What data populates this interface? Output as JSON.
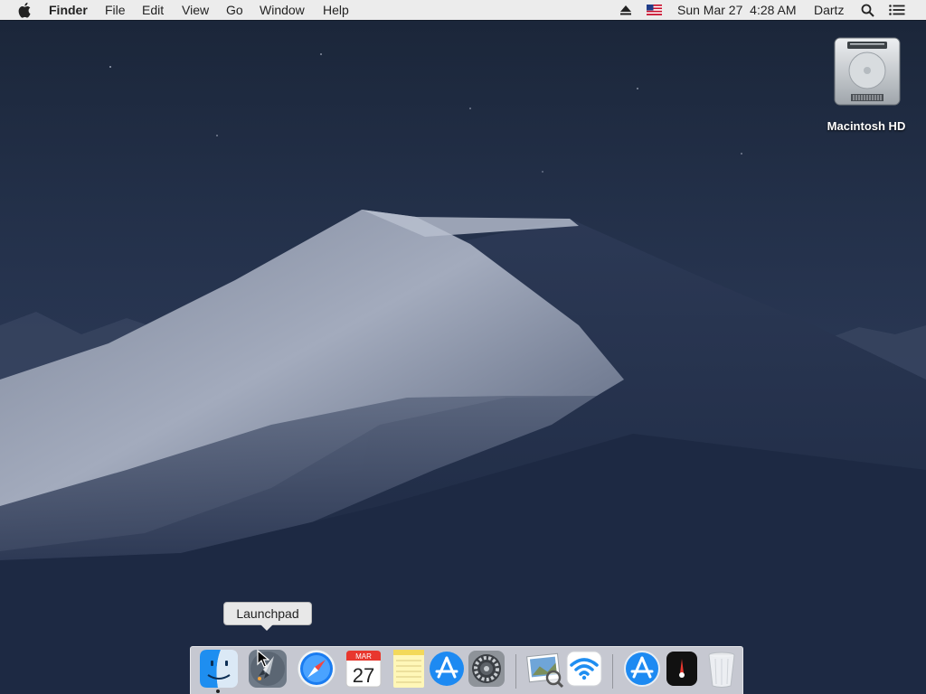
{
  "menubar": {
    "apple": "apple-icon",
    "app_name": "Finder",
    "menus": [
      "File",
      "Edit",
      "View",
      "Go",
      "Window",
      "Help"
    ],
    "status": {
      "eject": "eject-icon",
      "input_source": "us-flag-icon",
      "datetime": "Sun Mar 27  4:28 AM",
      "user": "Dartz",
      "spotlight": "spotlight-search-icon",
      "notification_center": "notification-center-icon"
    }
  },
  "desktop": {
    "wallpaper": "Mojave dark dunes",
    "icons": [
      {
        "label": "Macintosh HD",
        "icon": "hard-drive-icon"
      }
    ]
  },
  "tooltip": {
    "text": "Launchpad"
  },
  "dock": {
    "calendar": {
      "month": "MAR",
      "day": "27"
    },
    "items": [
      {
        "name": "Finder",
        "icon": "finder-icon",
        "running": true
      },
      {
        "name": "Launchpad",
        "icon": "launchpad-icon",
        "running": false
      },
      {
        "name": "Safari",
        "icon": "safari-icon",
        "running": false
      },
      {
        "name": "Calendar",
        "icon": "calendar-icon",
        "running": false
      },
      {
        "name": "Notes",
        "icon": "notes-icon",
        "running": false
      },
      {
        "name": "App Store",
        "icon": "app-store-icon",
        "running": false
      },
      {
        "name": "System Preferences",
        "icon": "system-preferences-icon",
        "running": false
      },
      {
        "name": "Preview",
        "icon": "preview-icon",
        "running": false
      },
      {
        "name": "Wireless Diagnostics",
        "icon": "wifi-icon",
        "running": false
      },
      {
        "name": "App Store Downloads",
        "icon": "downloads-app-store-icon",
        "running": false
      },
      {
        "name": "Dashboard",
        "icon": "dashboard-icon",
        "running": false
      },
      {
        "name": "Trash",
        "icon": "trash-icon",
        "running": false
      }
    ]
  },
  "colors": {
    "menubar_bg": "#ececec",
    "sky_dark": "#1a2538",
    "dune_light": "#9aa3b6",
    "accent_blue": "#1a7cf0"
  }
}
